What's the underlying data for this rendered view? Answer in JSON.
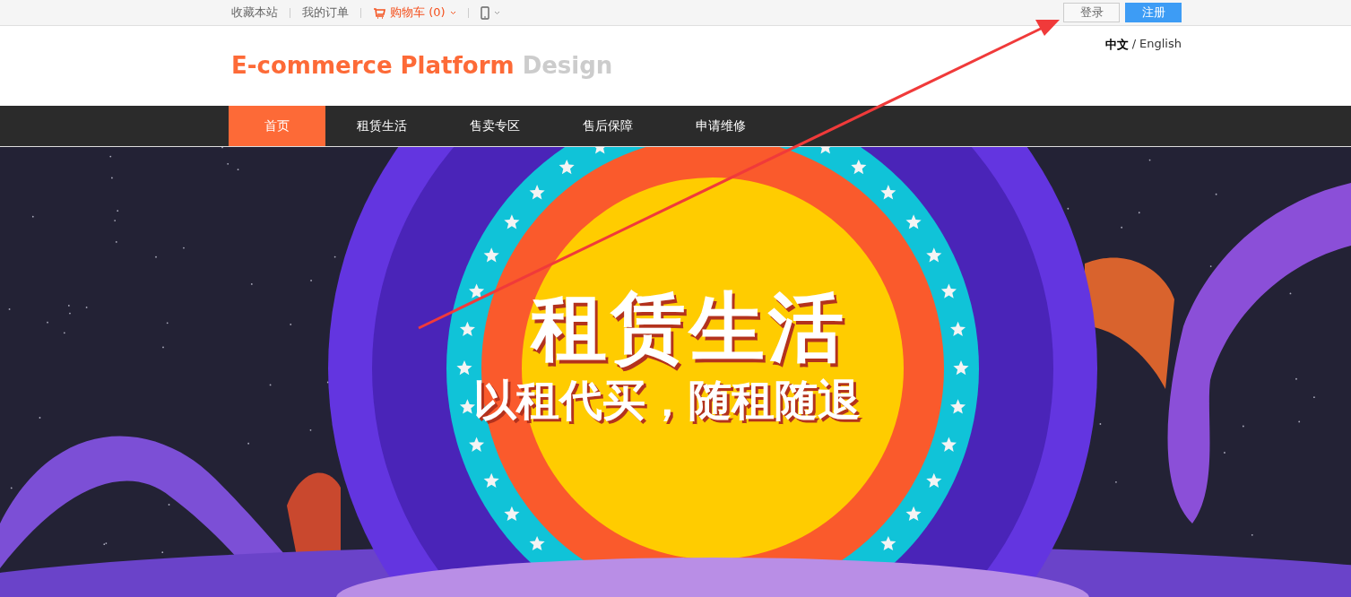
{
  "top_bar": {
    "links": [
      {
        "label": "收藏本站",
        "kind": "plain"
      },
      {
        "label": "我的订单",
        "kind": "plain"
      },
      {
        "label": "购物车",
        "count": "(0)",
        "kind": "cart"
      },
      {
        "kind": "phone"
      }
    ],
    "buttons": [
      {
        "label": "登录",
        "kind": "secondary"
      },
      {
        "label": "注册",
        "kind": "primary"
      }
    ]
  },
  "header": {
    "logo_primary": "E-commerce Platform",
    "logo_secondary": "Design",
    "languages": [
      {
        "label": "中文",
        "selected": true
      },
      {
        "label": "English",
        "selected": false
      }
    ],
    "language_separator": "/"
  },
  "nav": [
    {
      "label": "首页",
      "selected": true
    },
    {
      "label": "租赁生活",
      "selected": false
    },
    {
      "label": "售卖专区",
      "selected": false
    },
    {
      "label": "售后保障",
      "selected": false
    },
    {
      "label": "申请维修",
      "selected": false
    }
  ],
  "banner": {
    "title": "租赁生活",
    "subtitle": "以租代买，随租随退"
  }
}
